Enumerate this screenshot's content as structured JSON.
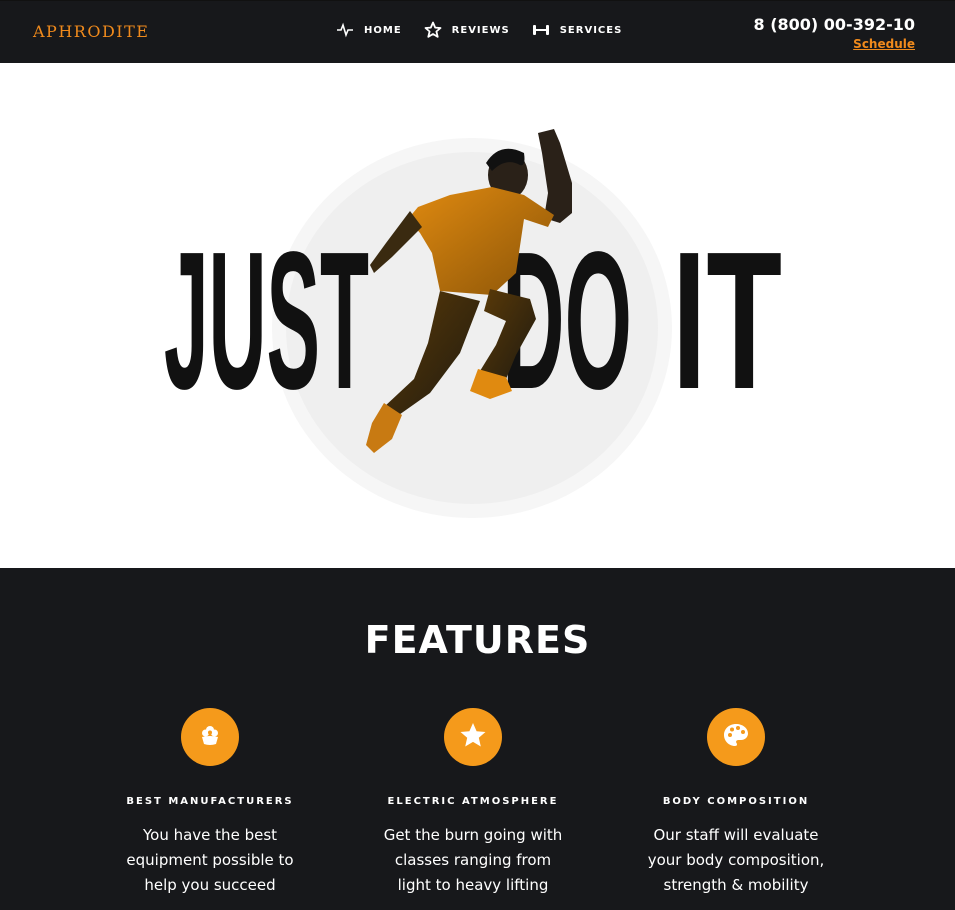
{
  "header": {
    "logo": "APHRODITE",
    "nav": [
      {
        "label": "HOME",
        "icon": "heartbeat-icon"
      },
      {
        "label": "REVIEWS",
        "icon": "star-outline-icon"
      },
      {
        "label": "SERVICES",
        "icon": "dumbbell-icon"
      }
    ],
    "phone": "8 (800) 00-392-10",
    "schedule_label": "Schedule"
  },
  "hero": {
    "headline_left": "JUST",
    "headline_mid": "DO",
    "headline_right": "IT"
  },
  "features": {
    "title": "FEATURES",
    "items": [
      {
        "icon": "flower-icon",
        "title": "BEST MANUFACTURERS",
        "lines": [
          "You have the best",
          "equipment possible to",
          "help you succeed"
        ]
      },
      {
        "icon": "star-icon",
        "title": "ELECTRIC ATMOSPHERE",
        "lines": [
          "Get the burn going with",
          "classes ranging from",
          "light to heavy lifting"
        ]
      },
      {
        "icon": "palette-icon",
        "title": "BODY COMPOSITION",
        "lines": [
          "Our staff will evaluate",
          "your body composition,",
          "strength & mobility"
        ]
      }
    ]
  },
  "colors": {
    "accent": "#f59a1b",
    "dark": "#17181b"
  }
}
